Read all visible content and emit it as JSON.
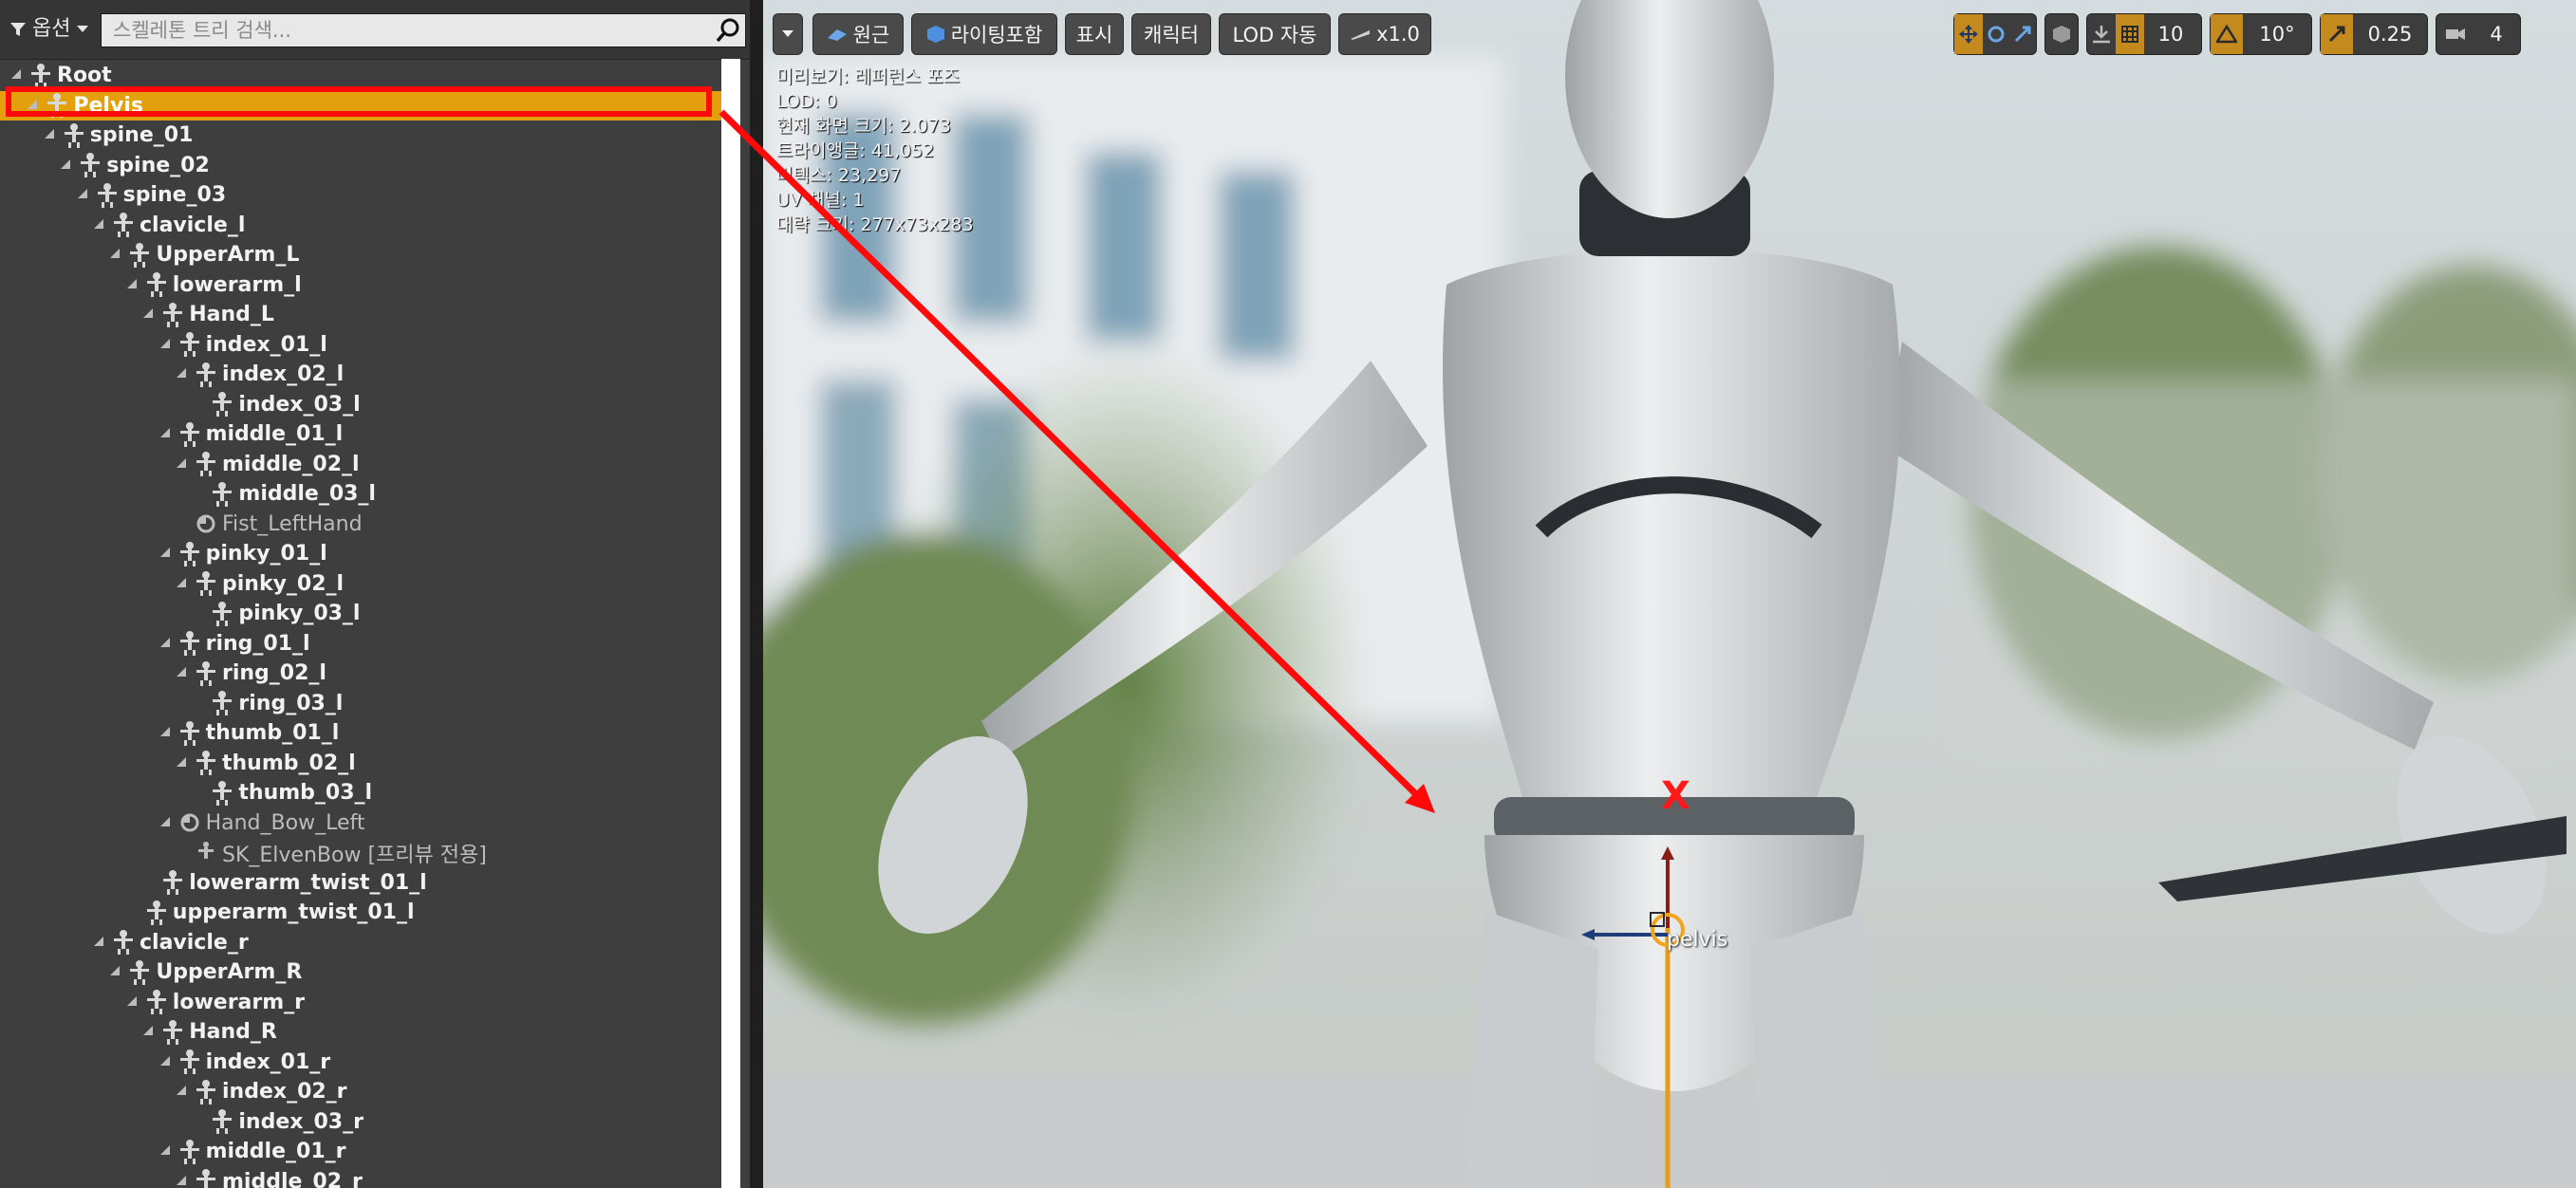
{
  "tree_header": {
    "options_label": "옵션",
    "search_placeholder": "스켈레톤 트리 검색..."
  },
  "bones": [
    {
      "label": "Root",
      "depth": 0,
      "kind": "bone",
      "expanded": true
    },
    {
      "label": "Pelvis",
      "depth": 1,
      "kind": "bone",
      "expanded": true,
      "selected": true
    },
    {
      "label": "spine_01",
      "depth": 2,
      "kind": "bone",
      "expanded": true
    },
    {
      "label": "spine_02",
      "depth": 3,
      "kind": "bone",
      "expanded": true
    },
    {
      "label": "spine_03",
      "depth": 4,
      "kind": "bone",
      "expanded": true
    },
    {
      "label": "clavicle_l",
      "depth": 5,
      "kind": "bone",
      "expanded": true
    },
    {
      "label": "UpperArm_L",
      "depth": 6,
      "kind": "bone",
      "expanded": true
    },
    {
      "label": "lowerarm_l",
      "depth": 7,
      "kind": "bone",
      "expanded": true
    },
    {
      "label": "Hand_L",
      "depth": 8,
      "kind": "bone",
      "expanded": true
    },
    {
      "label": "index_01_l",
      "depth": 9,
      "kind": "bone",
      "expanded": true
    },
    {
      "label": "index_02_l",
      "depth": 10,
      "kind": "bone",
      "expanded": true
    },
    {
      "label": "index_03_l",
      "depth": 11,
      "kind": "bone",
      "expanded": false
    },
    {
      "label": "middle_01_l",
      "depth": 9,
      "kind": "bone",
      "expanded": true
    },
    {
      "label": "middle_02_l",
      "depth": 10,
      "kind": "bone",
      "expanded": true
    },
    {
      "label": "middle_03_l",
      "depth": 11,
      "kind": "bone",
      "expanded": false
    },
    {
      "label": "Fist_LeftHand",
      "depth": 10,
      "kind": "socket",
      "expanded": false
    },
    {
      "label": "pinky_01_l",
      "depth": 9,
      "kind": "bone",
      "expanded": true
    },
    {
      "label": "pinky_02_l",
      "depth": 10,
      "kind": "bone",
      "expanded": true
    },
    {
      "label": "pinky_03_l",
      "depth": 11,
      "kind": "bone",
      "expanded": false
    },
    {
      "label": "ring_01_l",
      "depth": 9,
      "kind": "bone",
      "expanded": true
    },
    {
      "label": "ring_02_l",
      "depth": 10,
      "kind": "bone",
      "expanded": true
    },
    {
      "label": "ring_03_l",
      "depth": 11,
      "kind": "bone",
      "expanded": false
    },
    {
      "label": "thumb_01_l",
      "depth": 9,
      "kind": "bone",
      "expanded": true
    },
    {
      "label": "thumb_02_l",
      "depth": 10,
      "kind": "bone",
      "expanded": true
    },
    {
      "label": "thumb_03_l",
      "depth": 11,
      "kind": "bone",
      "expanded": false
    },
    {
      "label": "Hand_Bow_Left",
      "depth": 9,
      "kind": "socket",
      "expanded": true
    },
    {
      "label": "SK_ElvenBow [프리뷰 전용]",
      "depth": 10,
      "kind": "mesh",
      "expanded": false
    },
    {
      "label": "lowerarm_twist_01_l",
      "depth": 8,
      "kind": "bone",
      "expanded": false
    },
    {
      "label": "upperarm_twist_01_l",
      "depth": 7,
      "kind": "bone",
      "expanded": false
    },
    {
      "label": "clavicle_r",
      "depth": 5,
      "kind": "bone",
      "expanded": true
    },
    {
      "label": "UpperArm_R",
      "depth": 6,
      "kind": "bone",
      "expanded": true
    },
    {
      "label": "lowerarm_r",
      "depth": 7,
      "kind": "bone",
      "expanded": true
    },
    {
      "label": "Hand_R",
      "depth": 8,
      "kind": "bone",
      "expanded": true
    },
    {
      "label": "index_01_r",
      "depth": 9,
      "kind": "bone",
      "expanded": true
    },
    {
      "label": "index_02_r",
      "depth": 10,
      "kind": "bone",
      "expanded": true
    },
    {
      "label": "index_03_r",
      "depth": 11,
      "kind": "bone",
      "expanded": false
    },
    {
      "label": "middle_01_r",
      "depth": 9,
      "kind": "bone",
      "expanded": true
    },
    {
      "label": "middle_02_r",
      "depth": 10,
      "kind": "bone",
      "expanded": true
    }
  ],
  "toolbar": {
    "perspective": "원근",
    "lighting": "라이팅포함",
    "show": "표시",
    "character": "캐릭터",
    "lod": "LOD 자동",
    "speed": "x1.0",
    "grid_snap": "10",
    "rotation_snap": "10°",
    "scale_snap": "0.25",
    "camera_speed": "4"
  },
  "info": [
    "미리보기: 레퍼런스 포즈",
    "LOD: 0",
    "현재 화면 크기: 2.073",
    "트라이앵글: 41,052",
    "버텍스: 23,297",
    "UV 채널: 1",
    "대략 크기: 277x73x283"
  ],
  "viewport": {
    "gizmo_label": "pelvis",
    "annotation_marker": "X"
  },
  "colors": {
    "selection": "#e4a00c",
    "annotation": "#ff0a0a",
    "toolbar_accent": "#c48a1e"
  }
}
